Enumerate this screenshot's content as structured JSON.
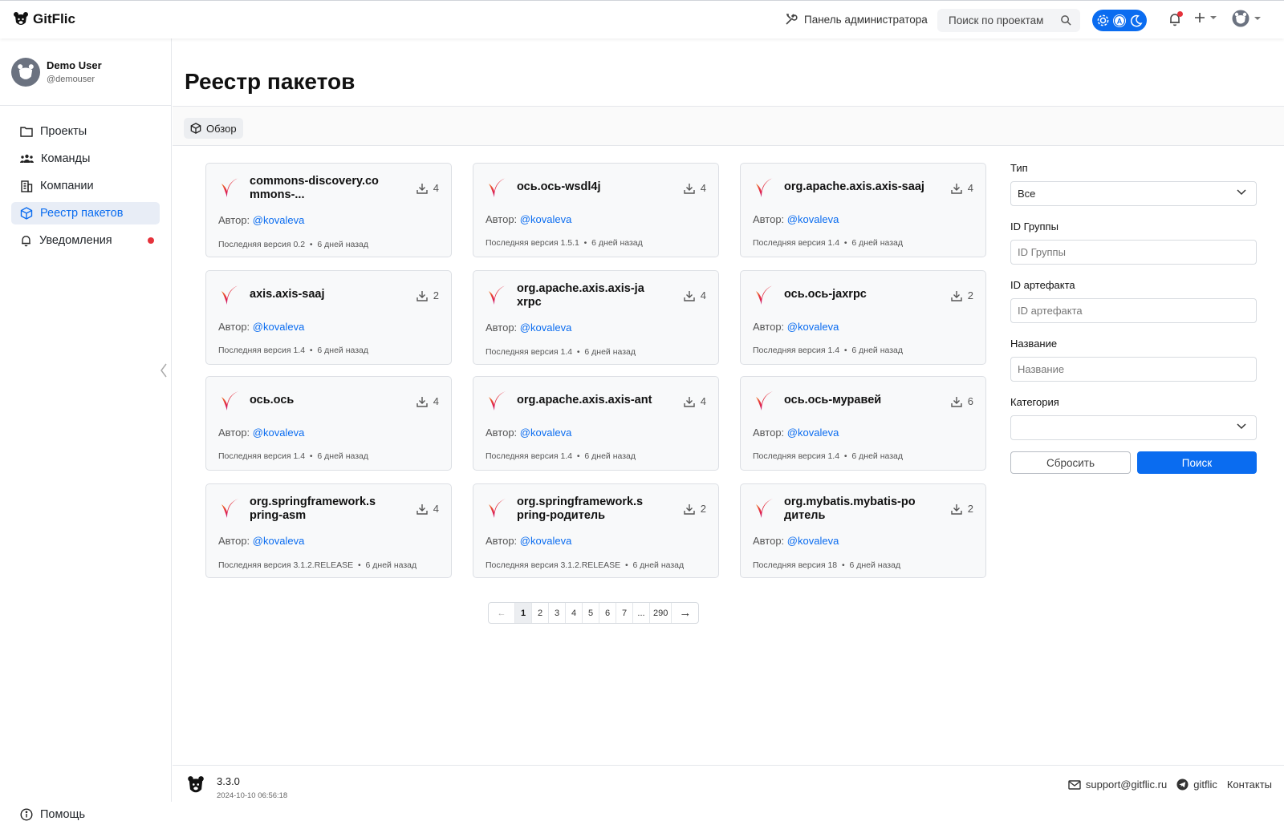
{
  "header": {
    "brand": "GitFlic",
    "admin_label": "Панель администратора",
    "search_placeholder": "Поиск по проектам"
  },
  "user": {
    "name": "Demo User",
    "handle": "@demouser"
  },
  "sidebar": {
    "items": [
      {
        "label": "Проекты",
        "icon": "folder-icon"
      },
      {
        "label": "Команды",
        "icon": "team-icon"
      },
      {
        "label": "Компании",
        "icon": "building-icon"
      },
      {
        "label": "Реестр пакетов",
        "icon": "package-icon",
        "active": true
      },
      {
        "label": "Уведомления",
        "icon": "bell-icon",
        "badge": true
      }
    ],
    "help_label": "Помощь"
  },
  "page": {
    "title": "Реестр пакетов",
    "tab_label": "Обзор"
  },
  "cards": [
    {
      "title": "commons-discovery.commons-...",
      "downloads": "4",
      "author_label": "Автор:",
      "author": "@kovaleva",
      "version": "Последняя версия 0.2",
      "age": "6 дней назад"
    },
    {
      "title": "ось.ось-wsdl4j",
      "downloads": "4",
      "author_label": "Автор:",
      "author": "@kovaleva",
      "version": "Последняя версия 1.5.1",
      "age": "6 дней назад"
    },
    {
      "title": "org.apache.axis.axis-saaj",
      "downloads": "4",
      "author_label": "Автор:",
      "author": "@kovaleva",
      "version": "Последняя версия 1.4",
      "age": "6 дней назад"
    },
    {
      "title": "axis.axis-saaj",
      "downloads": "2",
      "author_label": "Автор:",
      "author": "@kovaleva",
      "version": "Последняя версия 1.4",
      "age": "6 дней назад"
    },
    {
      "title": "org.apache.axis.axis-jaxrpc",
      "downloads": "4",
      "author_label": "Автор:",
      "author": "@kovaleva",
      "version": "Последняя версия 1.4",
      "age": "6 дней назад"
    },
    {
      "title": "ось.ось-jaxrpc",
      "downloads": "2",
      "author_label": "Автор:",
      "author": "@kovaleva",
      "version": "Последняя версия 1.4",
      "age": "6 дней назад"
    },
    {
      "title": "ось.ось",
      "downloads": "4",
      "author_label": "Автор:",
      "author": "@kovaleva",
      "version": "Последняя версия 1.4",
      "age": "6 дней назад"
    },
    {
      "title": "org.apache.axis.axis-ant",
      "downloads": "4",
      "author_label": "Автор:",
      "author": "@kovaleva",
      "version": "Последняя версия 1.4",
      "age": "6 дней назад"
    },
    {
      "title": "ось.ось-муравей",
      "downloads": "6",
      "author_label": "Автор:",
      "author": "@kovaleva",
      "version": "Последняя версия 1.4",
      "age": "6 дней назад"
    },
    {
      "title": "org.springframework.spring-asm",
      "downloads": "4",
      "author_label": "Автор:",
      "author": "@kovaleva",
      "version": "Последняя версия 3.1.2.RELEASE",
      "age": "6 дней назад"
    },
    {
      "title": "org.springframework.spring-родитель",
      "downloads": "2",
      "author_label": "Автор:",
      "author": "@kovaleva",
      "version": "Последняя версия 3.1.2.RELEASE",
      "age": "6 дней назад"
    },
    {
      "title": "org.mybatis.mybatis-родитель",
      "downloads": "2",
      "author_label": "Автор:",
      "author": "@kovaleva",
      "version": "Последняя версия 18",
      "age": "6 дней назад"
    }
  ],
  "filters": {
    "type_label": "Тип",
    "type_value": "Все",
    "group_label": "ID Группы",
    "group_placeholder": "ID Группы",
    "artifact_label": "ID артефакта",
    "artifact_placeholder": "ID артефакта",
    "name_label": "Название",
    "name_placeholder": "Название",
    "category_label": "Категория",
    "category_value": "",
    "reset_label": "Сбросить",
    "search_label": "Поиск"
  },
  "pagination": {
    "prev": "←",
    "next": "→",
    "current": "1",
    "pages": [
      "1",
      "2",
      "3",
      "4",
      "5",
      "6",
      "7",
      "...",
      "290"
    ]
  },
  "footer": {
    "version": "3.3.0",
    "build_date": "2024-10-10 06:56:18",
    "email": "support@gitflic.ru",
    "telegram": "gitflic",
    "contacts": "Контакты"
  },
  "colors": {
    "accent": "#0a6cf0",
    "badge": "#e5323b",
    "card_bg": "#f8f9fa"
  }
}
